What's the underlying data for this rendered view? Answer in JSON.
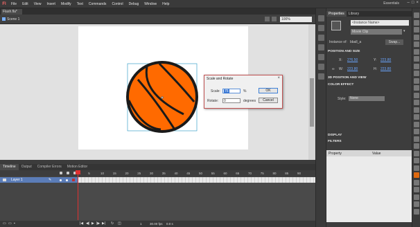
{
  "app": {
    "logo": "Fl",
    "menu": [
      "File",
      "Edit",
      "View",
      "Insert",
      "Modify",
      "Text",
      "Commands",
      "Control",
      "Debug",
      "Window",
      "Help"
    ],
    "workspace": "Essentials",
    "window_buttons": [
      "–",
      "□",
      "×"
    ]
  },
  "document": {
    "tab": "Flash.fla*",
    "scene": "Scene 1",
    "zoom": "100%"
  },
  "dialog": {
    "title": "Scale and Rotate",
    "close": "×",
    "scale_label": "Scale:",
    "scale_value": "75",
    "scale_unit": "%",
    "rotate_label": "Rotate:",
    "rotate_value": "0",
    "rotate_unit": "degrees",
    "ok": "OK",
    "cancel": "Cancel"
  },
  "timeline": {
    "tabs": [
      "Timeline",
      "Output",
      "Compiler Errors",
      "Motion Editor"
    ],
    "ruler": [
      "1",
      "5",
      "10",
      "15",
      "20",
      "25",
      "30",
      "35",
      "40",
      "45",
      "50",
      "55",
      "60",
      "65",
      "70",
      "75",
      "80",
      "85",
      "90"
    ],
    "layer": "Layer 1",
    "fps": "30.00 fps",
    "time": "0.0 s",
    "frame": "1"
  },
  "properties": {
    "tabs": [
      "Properties",
      "Library"
    ],
    "instance_name_placeholder": "<Instance Name>",
    "symbol_type": "Movie Clip",
    "instance_of_label": "Instance of:",
    "instance_of": "bball_a",
    "swap": "Swap...",
    "position_size": "POSITION AND SIZE",
    "x_label": "X:",
    "x_value": "276.50",
    "y_label": "Y:",
    "y_value": "223.80",
    "w_label": "W:",
    "w_value": "223.80",
    "h_label": "H:",
    "h_value": "223.80",
    "three_d": "3D POSITION AND VIEW",
    "color_effect": "COLOR EFFECT",
    "style_label": "Style:",
    "style_value": "None",
    "display": "DISPLAY",
    "filters": "FILTERS",
    "col_property": "Property",
    "col_value": "Value"
  },
  "colors": {
    "ball_fill": "#ff6a00",
    "ball_stroke": "#1a1a1a",
    "playhead": "#e03030",
    "layer_highlight": "#5b7db8"
  }
}
